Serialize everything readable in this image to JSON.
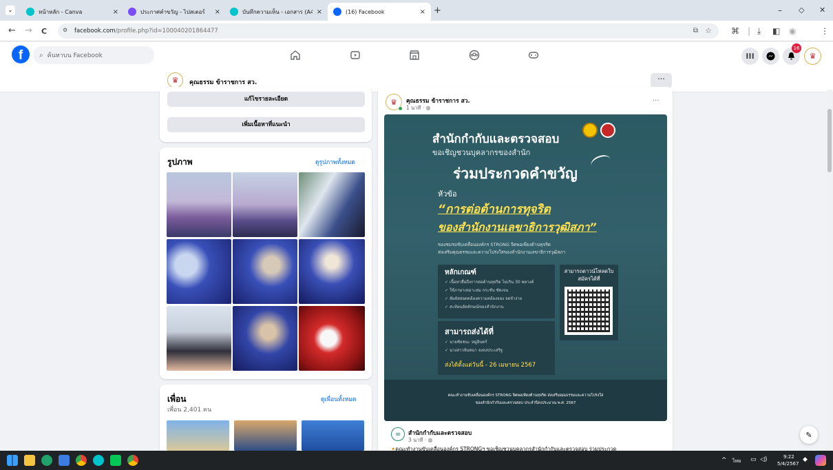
{
  "browser": {
    "tabs": [
      {
        "title": "หน้าหลัก - Canva",
        "close": "×",
        "color": "#00c4cc"
      },
      {
        "title": "ประกาศคำขวัญ - ไปสเตอร์",
        "close": "×",
        "color": "#7c4dff"
      },
      {
        "title": "บันทึกความเห็น - เอกสาร (A4)",
        "close": "×",
        "color": "#00c4cc"
      },
      {
        "title": "(16) Facebook",
        "close": "×",
        "color": "#0866ff"
      }
    ],
    "new_tab": "+",
    "window_controls": {
      "minimize": "–",
      "restore": "◇",
      "close": "✕"
    },
    "back": "←",
    "forward": "→",
    "reload": "C",
    "url_host": "facebook.com",
    "url_path": "/profile.php?id=100040201864477"
  },
  "facebook": {
    "logo": "f",
    "search_placeholder": "ค้นหาบน Facebook",
    "notification_count": "16",
    "accent": "#0866ff"
  },
  "profile_bar": {
    "name": "คุณธรรม ข้าราชการ สว.",
    "more": "···"
  },
  "left": {
    "edit_details": "แก้ไขรายละเอียด",
    "add_featured": "เพิ่มเนื้อหาที่แนะนำ",
    "photos_title": "รูปภาพ",
    "photos_link": "ดูรูปภาพทั้งหมด",
    "friends_title": "เพื่อน",
    "friends_count": "เพื่อน 2,401 คน",
    "friends_link": "ดูเพื่อนทั้งหมด"
  },
  "post": {
    "author": "คุณธรรม ข้าราชการ สว.",
    "time": "1 นาที · ",
    "more": "···",
    "poster": {
      "header": "สำนักกำกับและตรวจสอบ",
      "invite": "ขอเชิญชวนบุคลากรของสำนัก",
      "headline": "ร่วมประกวดคำขวัญ",
      "topic_label": "หัวข้อ",
      "topic_line1": "“การต่อต้านการทุจริต",
      "topic_line2": "ของสำนักงานเลขาธิการวุฒิสภา”",
      "desc1": "ของชมรมขับเคลื่อนองค์กร STRONG จิตพอเพียงต้านทุจริต",
      "desc2": "ส่งเสริมคุณธรรมและความโปร่งใสของสำนักงานเลขาธิการวุฒิสภา",
      "criteria_title": "หลักเกณฑ์",
      "criteria": [
        "เนื้อหาสื่อถึงการต่อต้านทุจริต ไม่เกิน 30 พยางค์",
        "ใช้ภาษาเหมาะสม กระชับ ชัดเจน",
        "สัมผัสสอดคล้องความคล้องจอง จดจำง่าย",
        "สะท้อนอัตลักษณ์ของสำนักงาน"
      ],
      "download_title": "สามารถดาวน์โหลดใบสมัครได้ที่",
      "send_title": "สามารถส่งได้ที่",
      "send_list": [
        "นายชัยชนะ หมู่อินทร์",
        "นางสาวจันทนา จงจงประเสริฐ"
      ],
      "deadline": "ส่งได้ตั้งแต่วันนี้ - 26 เมษายน 2567",
      "footer1": "คณะทำงานขับเคลื่อนองค์กร STRONG จิตพอเพียงต้านทุจริต ส่งเสริมคุณธรรมและความโปร่งใส",
      "footer2": "ของสำนักกำกับและตรวจสอบ ประจำปีงบประมาณ พ.ศ. 2567"
    },
    "shared_author": "สำนักกำกับและตรวจสอบ",
    "shared_time": "3 นาที · ",
    "shared_text": "คณะทำงานขับเคลื่อนองค์กร STRONGฯ ขอเชิญชวนบุคลากรสำนักกำกับและตรวจสอบ ร่วมประกวด"
  },
  "taskbar": {
    "time": "9:22",
    "date": "5/4/2567",
    "lang": "ไทย"
  }
}
